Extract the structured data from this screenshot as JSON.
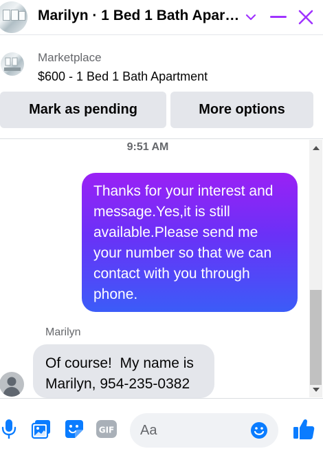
{
  "header": {
    "title": "Marilyn · 1 Bed 1 Bath Apar…",
    "icons": [
      "house-photo",
      "chevron-down-icon",
      "minimize-icon",
      "close-icon"
    ],
    "accent_color": "#a033ff"
  },
  "listing": {
    "source": "Marketplace",
    "title": "$600 - 1 Bed 1 Bath Apartment"
  },
  "actions": {
    "mark_pending": "Mark as pending",
    "more_options": "More options"
  },
  "chat": {
    "timestamp": "9:51 AM",
    "outgoing": {
      "lines": [
        "Thanks for your interest and",
        "message.Yes,it is still",
        "available.Please send me",
        "your number so that we can",
        "contact with you through",
        "phone."
      ],
      "gradient": [
        "#9a21f5",
        "#3b5cf8"
      ]
    },
    "incoming": {
      "sender": "Marilyn",
      "text": "Of course!  My name is\nMarilyn, 954-235-0382"
    }
  },
  "composer": {
    "placeholder": "Aa",
    "tools": [
      "microphone-icon",
      "photo-icon",
      "sticker-icon",
      "gif-icon",
      "emoji-icon",
      "thumbs-up-icon"
    ],
    "tool_color": "#0a7cff"
  }
}
